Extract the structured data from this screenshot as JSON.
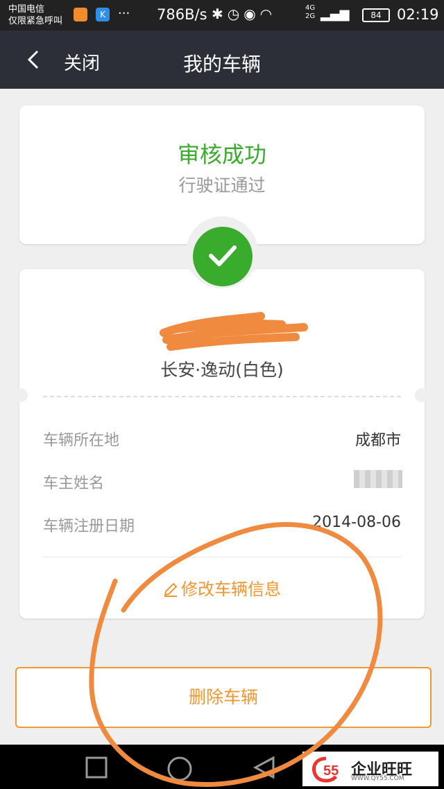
{
  "status_bar": {
    "carrier_line1": "中国电信",
    "carrier_line2": "仅限紧急呼叫",
    "app_icon_2_letter": "K",
    "more": "···",
    "net_speed": "786B/s",
    "icons": [
      "bluetooth-icon",
      "alarm-icon",
      "eye-icon",
      "wifi-icon"
    ],
    "net_4g": "4G",
    "net_2g": "2G",
    "battery": "84",
    "time": "02:19"
  },
  "header": {
    "back_icon": "chevron-left-icon",
    "close_label": "关闭",
    "title": "我的车辆"
  },
  "status_card": {
    "title": "审核成功",
    "subtitle": "行驶证通过",
    "title_color": "#3aac2d"
  },
  "vehicle": {
    "model": "长安·逸动(白色)",
    "rows": [
      {
        "label": "车辆所在地",
        "value": "成都市"
      },
      {
        "label": "车主姓名",
        "value": ""
      },
      {
        "label": "车辆注册日期",
        "value": "2014-08-06"
      }
    ],
    "edit_label": "修改车辆信息"
  },
  "delete_label": "删除车辆",
  "accent_color": "#f2962f",
  "nav": [
    "recent-apps-icon",
    "home-icon",
    "back-icon"
  ],
  "watermark": {
    "logo_text": "55",
    "name": "企业旺旺",
    "url": "WWW.QY55.COM"
  }
}
